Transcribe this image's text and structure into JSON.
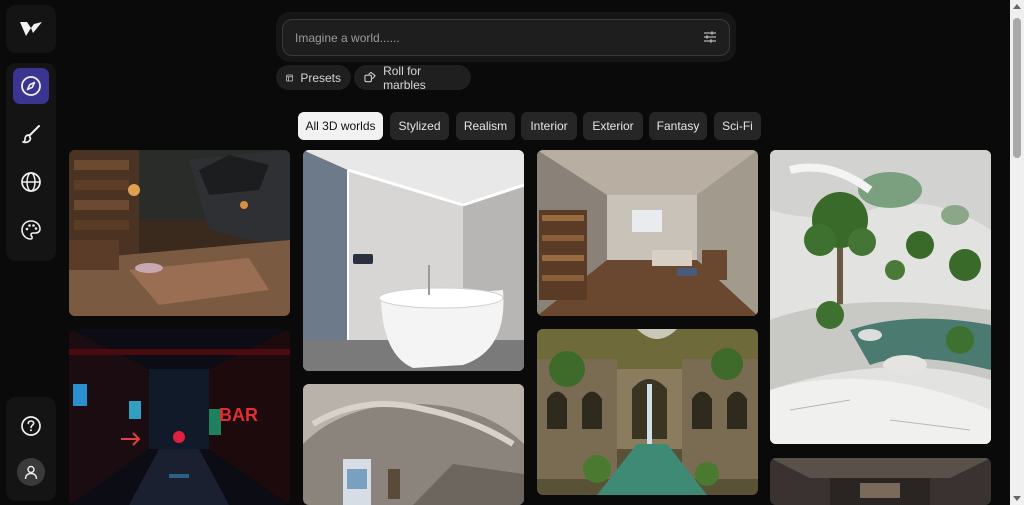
{
  "search": {
    "placeholder": "Imagine a world......"
  },
  "actions": {
    "presets_label": "Presets",
    "roll_label": "Roll for marbles"
  },
  "tabs": [
    {
      "label": "All 3D worlds",
      "active": true
    },
    {
      "label": "Stylized"
    },
    {
      "label": "Realism"
    },
    {
      "label": "Interior"
    },
    {
      "label": "Exterior"
    },
    {
      "label": "Fantasy"
    },
    {
      "label": "Sci-Fi"
    }
  ],
  "sidebar": {
    "items": [
      "explore-icon",
      "brush-icon",
      "globe-icon",
      "palette-icon"
    ],
    "bottom": [
      "help-icon",
      "user-icon"
    ]
  },
  "colors": {
    "accent": "#3a3590",
    "background": "#0a0a0a"
  }
}
